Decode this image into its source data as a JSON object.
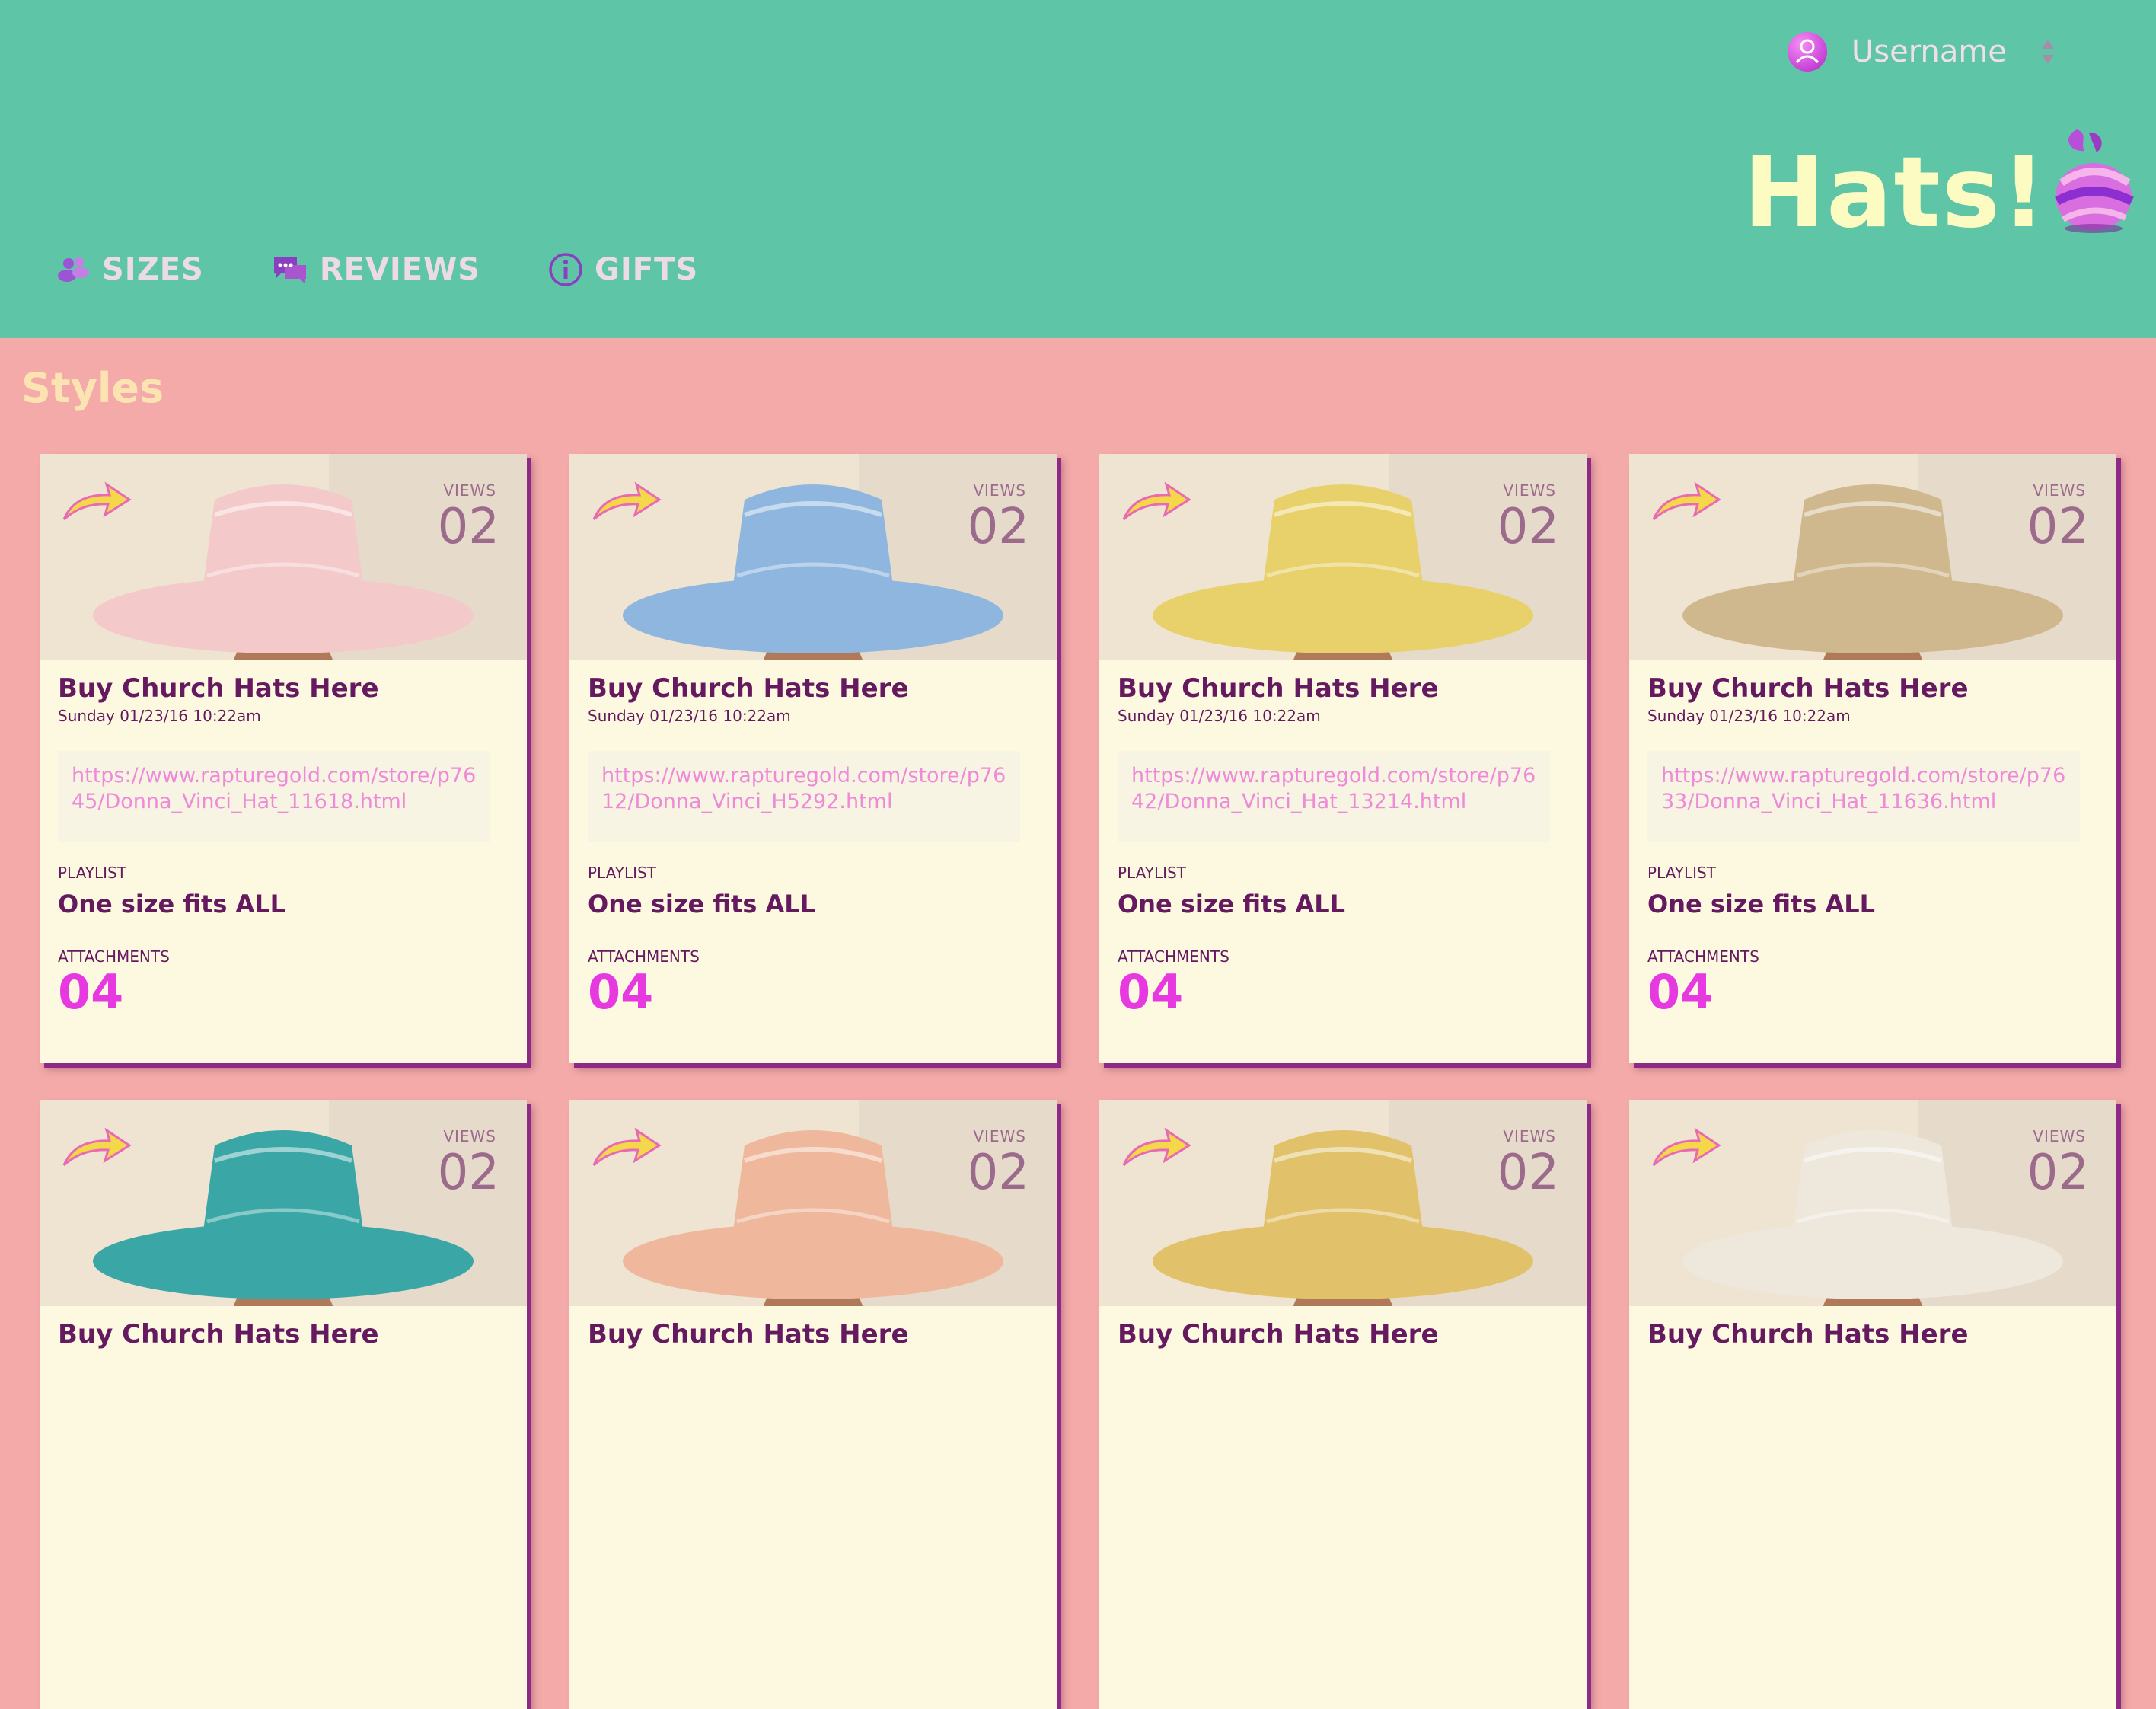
{
  "header": {
    "username": "Username",
    "brand": "Hats!",
    "colors": {
      "header_bg": "#5ec5a7",
      "page_bg": "#f4aaa8",
      "brand": "#fbfbc2",
      "accent": "#e63ae0"
    }
  },
  "nav": {
    "items": [
      {
        "label": "SIZES",
        "icon": "users-icon"
      },
      {
        "label": "REVIEWS",
        "icon": "chat-icon"
      },
      {
        "label": "GIFTS",
        "icon": "info-icon"
      }
    ]
  },
  "main": {
    "section_title": "Styles",
    "cards": [
      {
        "title": "Buy Church Hats Here",
        "date": "Sunday 01/23/16 10:22am",
        "link": "https://www.rapturegold.com/store/p7645/Donna_Vinci_Hat_11618.html",
        "views_label": "VIEWS",
        "views": "02",
        "playlist_label": "PLAYLIST",
        "playlist": "One size fits ALL",
        "attachments_label": "ATTACHMENTS",
        "attachments": "04",
        "hat_color": "#f4c9c9"
      },
      {
        "title": "Buy Church Hats Here",
        "date": "Sunday 01/23/16 10:22am",
        "link": "https://www.rapturegold.com/store/p7612/Donna_Vinci_H5292.html",
        "views_label": "VIEWS",
        "views": "02",
        "playlist_label": "PLAYLIST",
        "playlist": "One size fits ALL",
        "attachments_label": "ATTACHMENTS",
        "attachments": "04",
        "hat_color": "#8fb6df"
      },
      {
        "title": "Buy Church Hats Here",
        "date": "Sunday 01/23/16 10:22am",
        "link": "https://www.rapturegold.com/store/p7642/Donna_Vinci_Hat_13214.html",
        "views_label": "VIEWS",
        "views": "02",
        "playlist_label": "PLAYLIST",
        "playlist": "One size fits ALL",
        "attachments_label": "ATTACHMENTS",
        "attachments": "04",
        "hat_color": "#e8d06a"
      },
      {
        "title": "Buy Church Hats Here",
        "date": "Sunday 01/23/16 10:22am",
        "link": "https://www.rapturegold.com/store/p7633/Donna_Vinci_Hat_11636.html",
        "views_label": "VIEWS",
        "views": "02",
        "playlist_label": "PLAYLIST",
        "playlist": "One size fits ALL",
        "attachments_label": "ATTACHMENTS",
        "attachments": "04",
        "hat_color": "#cfb88e"
      },
      {
        "title": "Buy Church Hats Here",
        "views_label": "VIEWS",
        "views": "02",
        "hat_color": "#3aa6a6"
      },
      {
        "title": "Buy Church Hats Here",
        "views_label": "VIEWS",
        "views": "02",
        "hat_color": "#efb89c"
      },
      {
        "title": "Buy Church Hats Here",
        "views_label": "VIEWS",
        "views": "02",
        "hat_color": "#e1c26b"
      },
      {
        "title": "Buy Church Hats Here",
        "views_label": "VIEWS",
        "views": "02",
        "hat_color": "#ede7dc"
      }
    ]
  }
}
